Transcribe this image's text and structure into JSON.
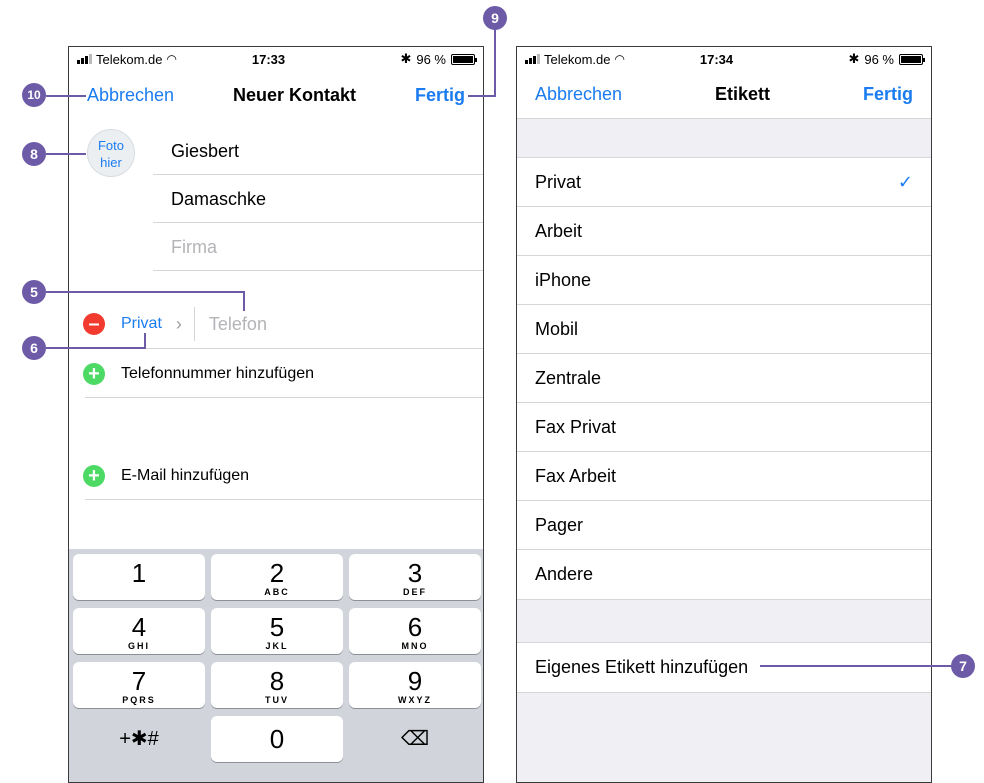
{
  "left": {
    "status": {
      "carrier": "Telekom.de",
      "time": "17:33",
      "battery": "96 %"
    },
    "nav": {
      "cancel": "Abbrechen",
      "title": "Neuer Kontakt",
      "done": "Fertig"
    },
    "photo_label": "Foto hier",
    "fields": {
      "first_name": "Giesbert",
      "last_name": "Damaschke",
      "company_placeholder": "Firma"
    },
    "phone_row": {
      "label": "Privat",
      "placeholder": "Telefon"
    },
    "add_phone": "Telefonnummer hinzufügen",
    "add_email": "E-Mail hinzufügen",
    "keypad": [
      {
        "num": "1",
        "letters": ""
      },
      {
        "num": "2",
        "letters": "ABC"
      },
      {
        "num": "3",
        "letters": "DEF"
      },
      {
        "num": "4",
        "letters": "GHI"
      },
      {
        "num": "5",
        "letters": "JKL"
      },
      {
        "num": "6",
        "letters": "MNO"
      },
      {
        "num": "7",
        "letters": "PQRS"
      },
      {
        "num": "8",
        "letters": "TUV"
      },
      {
        "num": "9",
        "letters": "WXYZ"
      }
    ],
    "keypad_symbols": "+✱#",
    "keypad_zero": "0",
    "keypad_delete": "⌫"
  },
  "right": {
    "status": {
      "carrier": "Telekom.de",
      "time": "17:34",
      "battery": "96 %"
    },
    "nav": {
      "cancel": "Abbrechen",
      "title": "Etikett",
      "done": "Fertig"
    },
    "labels": [
      "Privat",
      "Arbeit",
      "iPhone",
      "Mobil",
      "Zentrale",
      "Fax Privat",
      "Fax Arbeit",
      "Pager",
      "Andere"
    ],
    "selected": "Privat",
    "check": "✓",
    "custom_label": "Eigenes Etikett hinzufügen"
  },
  "callouts": {
    "c5": "5",
    "c6": "6",
    "c7": "7",
    "c8": "8",
    "c9": "9",
    "c10": "10"
  },
  "colors": {
    "accent": "#1a7cf0",
    "callout": "#6d5ba7",
    "delete": "#f23a2f",
    "add": "#4cd964"
  }
}
